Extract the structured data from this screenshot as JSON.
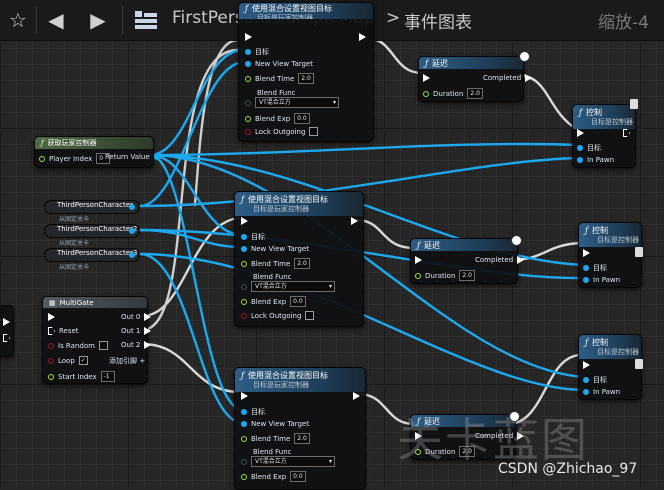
{
  "toolbar": {
    "breadcrumb_map": "FirstPersonExampleMap",
    "breadcrumb_separator": ">",
    "breadcrumb_graph": "事件图表",
    "zoom_text": "缩放-4"
  },
  "icons": [
    "star-icon",
    "back-arrow-icon",
    "forward-arrow-icon",
    "blueprint-grid-icon",
    "clock-icon",
    "library-icon"
  ],
  "common": {
    "set_view_blend_title": "使用混合设置视图目标",
    "set_view_blend_sub": "目标是玩家控制器",
    "target": "目标",
    "new_view_target": "New View Target",
    "blend_time": "Blend Time",
    "blend_time_val": "2.0",
    "blend_func": "Blend Func",
    "blend_func_val": "VT混合立方",
    "blend_exp": "Blend Exp",
    "blend_exp_val": "0.0",
    "lock_outgoing": "Lock Outgoing",
    "delay_title": "延迟",
    "completed": "Completed",
    "duration": "Duration",
    "duration_val": "2.0",
    "possess_title": "控制",
    "possess_sub": "目标是控制器",
    "in_pawn": "In Pawn"
  },
  "get_player_controller": {
    "title": "获取玩家控制器",
    "player_index": "Player Index",
    "player_index_val": "0",
    "return_value": "Return Value"
  },
  "variables": [
    {
      "name": "ThirdPersonCharacter",
      "sub": "从固定关卡"
    },
    {
      "name": "ThirdPersonCharacter2",
      "sub": "从固定关卡"
    },
    {
      "name": "ThirdPersonCharacter3",
      "sub": "从固定关卡"
    }
  ],
  "multigate": {
    "title": "MultiGate",
    "reset": "Reset",
    "is_random": "Is Random",
    "loop": "Loop",
    "loop_checked": "✓",
    "start_index": "Start Index",
    "start_index_val": "-1",
    "out0": "Out 0",
    "out1": "Out 1",
    "out2": "Out 2",
    "add_pin": "添加引脚 +"
  },
  "watermark": "关卡蓝图",
  "credit": "CSDN @Zhichao_97",
  "colors": {
    "exec": "#ffffff",
    "object_pin": "#1ca9ef",
    "float_pin": "#9ae23a",
    "bool_pin": "#a3121b",
    "background": "#262626"
  }
}
